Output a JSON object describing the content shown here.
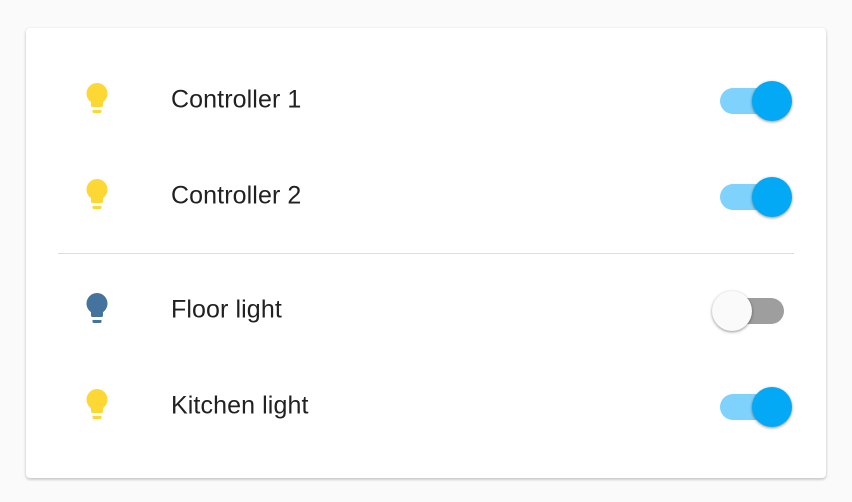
{
  "colors": {
    "bulb_on": "#fdd835",
    "bulb_off": "#44739e",
    "switch_on_thumb": "#03a9f4",
    "switch_on_track": "#7fd2fc",
    "switch_off_thumb": "#fafafa",
    "switch_off_track": "#9e9e9e"
  },
  "entities": [
    {
      "name": "Controller 1",
      "icon": "lightbulb-icon",
      "state": "on"
    },
    {
      "name": "Controller 2",
      "icon": "lightbulb-icon",
      "state": "on"
    },
    {
      "name": "Floor light",
      "icon": "lightbulb-icon",
      "state": "off"
    },
    {
      "name": "Kitchen light",
      "icon": "lightbulb-icon",
      "state": "on"
    }
  ]
}
